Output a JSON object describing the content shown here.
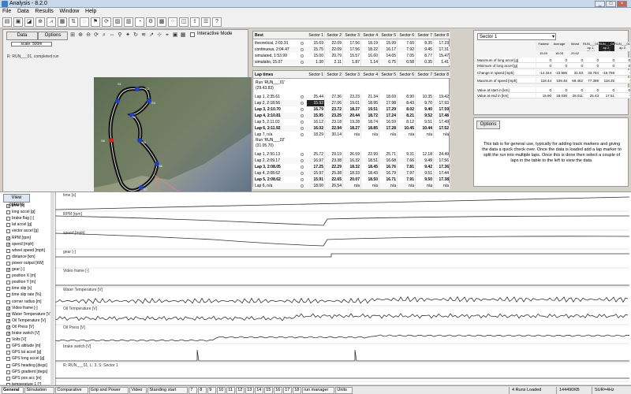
{
  "window": {
    "title": "Analysis - 8.2.0",
    "min": "_",
    "max": "□",
    "close": "×"
  },
  "menu": [
    "File",
    "Data",
    "Results",
    "Window",
    "Help"
  ],
  "map_panel": {
    "data_button": "Data",
    "options_button": "Options",
    "scale_label": "scale: 500m",
    "run_label": "R: RUN___01, completed run",
    "interactive_label": "Interactive Mode",
    "sector_labels": [
      "S1",
      "S2",
      "S3",
      "S4",
      "S5",
      "S6",
      "S7",
      "S8"
    ]
  },
  "best_table": {
    "header": [
      "Best",
      "Sector 1",
      "Sector 2",
      "Sector 3",
      "Sector 4",
      "Sector 5",
      "Sector 6",
      "Sector 7",
      "Sector 8"
    ],
    "rows": [
      {
        "label": "theoretical, 2:03.91",
        "cells": [
          "15.69",
          "22.09",
          "17.56",
          "18.19",
          "15.99",
          "7.60",
          "9.35",
          "17.23"
        ]
      },
      {
        "label": "continuous, 2:04.47",
        "cells": [
          "15.75",
          "22.09",
          "17.56",
          "18.22",
          "16.17",
          "7.92",
          "9.45",
          "17.31"
        ]
      },
      {
        "label": "simulated, 1:53.99",
        "cells": [
          "15.00",
          "20.79",
          "15.57",
          "16.60",
          "14.65",
          "7.05",
          "8.77",
          "15.47"
        ]
      },
      {
        "label": "simulatio, 15.07",
        "cells": [
          "1.30",
          "2.11",
          "1.87",
          "1.14",
          "0.75",
          "0.58",
          "0.35",
          "1.41"
        ]
      }
    ]
  },
  "laps_table": {
    "header": [
      "Lap times",
      "Sector 1",
      "Sector 2",
      "Sector 3",
      "Sector 4",
      "Sector 5",
      "Sector 6",
      "Sector 7",
      "Sector 8"
    ],
    "run1_label": "Run 'RUN___01'",
    "run1_sub": "(29.43.83)",
    "run2_label": "Run 'RUN___02'",
    "run2_sub": "(31.05.70)",
    "run1": [
      {
        "label": "Lap 1, 2:35.61",
        "cells": [
          "25.44",
          "27.36",
          "23.23",
          "21.34",
          "18.69",
          "8.90",
          "10.35",
          "19.42"
        ]
      },
      {
        "label": "Lap 2, 2:18.56",
        "cells": [
          "15.92",
          "27.06",
          "19.01",
          "18.95",
          "17.98",
          "8.43",
          "9.70",
          "17.93"
        ]
      },
      {
        "label": "Lap 3, 2:10.70",
        "cells": [
          "16.79",
          "23.72",
          "18.37",
          "19.51",
          "17.29",
          "8.02",
          "9.40",
          "17.59"
        ]
      },
      {
        "label": "Lap 4, 2:10.81",
        "cells": [
          "15.95",
          "23.25",
          "20.44",
          "18.72",
          "17.24",
          "8.21",
          "9.52",
          "17.48"
        ]
      },
      {
        "label": "Lap 5, 2:11.03",
        "cells": [
          "16.12",
          "23.18",
          "19.28",
          "18.74",
          "16.59",
          "8.12",
          "9.51",
          "17.49"
        ]
      },
      {
        "label": "Lap 6, 2:11.92",
        "cells": [
          "16.02",
          "22.94",
          "18.27",
          "18.85",
          "17.28",
          "10.45",
          "10.44",
          "17.52"
        ]
      },
      {
        "label": "Lap 7, n/a",
        "cells": [
          "18.29",
          "30.14",
          "n/a",
          "n/a",
          "n/a",
          "n/a",
          "n/a",
          "n/a"
        ]
      }
    ],
    "run2": [
      {
        "label": "Lap 1, 2:50.13",
        "cells": [
          "25.72",
          "29.19",
          "26.59",
          "22.99",
          "25.71",
          "9.31",
          "12.18",
          "24.49"
        ]
      },
      {
        "label": "Lap 2, 2:09.17",
        "cells": [
          "16.97",
          "23.38",
          "16.32",
          "18.51",
          "16.68",
          "7.66",
          "9.49",
          "17.56"
        ]
      },
      {
        "label": "Lap 3, 2:08.05",
        "cells": [
          "17.25",
          "22.29",
          "18.32",
          "18.45",
          "16.76",
          "7.81",
          "9.42",
          "17.36"
        ]
      },
      {
        "label": "Lap 4, 2:08.62",
        "cells": [
          "15.97",
          "25.38",
          "18.33",
          "18.43",
          "16.79",
          "7.97",
          "9.51",
          "17.44"
        ]
      },
      {
        "label": "Lap 5, 2:08.62",
        "cells": [
          "15.91",
          "22.65",
          "20.07",
          "18.50",
          "16.71",
          "7.91",
          "9.50",
          "17.38"
        ]
      },
      {
        "label": "Lap 6, n/a",
        "cells": [
          "18.00",
          "26.54",
          "n/a",
          "n/a",
          "n/a",
          "n/a",
          "n/a",
          "n/a"
        ]
      }
    ]
  },
  "sector_panel": {
    "dropdown": "Sector 1",
    "header": [
      "Fastest",
      "Average",
      "Worst",
      "RUN___01 ap 1, 23.44",
      "RUN___01 ap 2, 17.92",
      "RUN___01 ap 3"
    ],
    "header_sub": [
      "15.69",
      "18.05",
      "29.62",
      "",
      "",
      ""
    ],
    "rows": [
      {
        "label": "Maximum of long accel [g]",
        "cells": [
          "0",
          "0",
          "0",
          "0",
          "0",
          "0"
        ]
      },
      {
        "label": "Minimum of long accel [g]",
        "cells": [
          "0",
          "0",
          "0",
          "0",
          "0",
          "0"
        ]
      },
      {
        "label": "Change in speed [mph]",
        "cells": [
          "-14.344",
          "-10.586",
          "31.83",
          "33.784",
          "-16.758",
          "-"
        ]
      },
      {
        "label": "Maximum of speed [mph]",
        "cells": [
          "118.44",
          "109.46",
          "69.462",
          "77.389",
          "118.25",
          "-"
        ]
      },
      {
        "label": "Value at start in [km]",
        "cells": [
          "0",
          "0",
          "0",
          "0",
          "0",
          "0"
        ]
      },
      {
        "label": "Value at end in [km]",
        "cells": [
          "15.90",
          "18.036",
          "28.011",
          "25.43",
          "17.51",
          "-"
        ]
      }
    ]
  },
  "info_panel": {
    "options_button": "Options",
    "text": "This tab is for general use, typically for adding track markers and giving the data a quick check over. Once the data is loaded add a lap marker to split the run into multiple laps. Once this is done then select a couple of laps in the table to the left to view the data."
  },
  "channels": {
    "view_options": "View options",
    "items": [
      {
        "name": "time [s]",
        "checked": true
      },
      {
        "name": "long accel [g]",
        "checked": false
      },
      {
        "name": "brake flag [-]",
        "checked": false
      },
      {
        "name": "lat accel [g]",
        "checked": false
      },
      {
        "name": "vector accel [g]",
        "checked": false
      },
      {
        "name": "RPM [rpm]",
        "checked": true
      },
      {
        "name": "speed [mph]",
        "checked": true
      },
      {
        "name": "wheel speed [mph]",
        "checked": false
      },
      {
        "name": "distance [km]",
        "checked": false
      },
      {
        "name": "power output [kW]",
        "checked": false
      },
      {
        "name": "gear [-]",
        "checked": true
      },
      {
        "name": "position X [m]",
        "checked": false
      },
      {
        "name": "position Y [m]",
        "checked": false
      },
      {
        "name": "time slip [s]",
        "checked": false
      },
      {
        "name": "time slip rate [%]",
        "checked": false
      },
      {
        "name": "corner radius [m]",
        "checked": false
      },
      {
        "name": "Video frame [-]",
        "checked": true
      },
      {
        "name": "Water Temperature [V]",
        "checked": true
      },
      {
        "name": "Oil Temperature [V]",
        "checked": true
      },
      {
        "name": "Oil Press [V]",
        "checked": true
      },
      {
        "name": "brake switch [V]",
        "checked": true
      },
      {
        "name": "Volts [V]",
        "checked": false
      },
      {
        "name": "GPS altitude [m]",
        "checked": false
      },
      {
        "name": "GPS lat accel [g]",
        "checked": false
      },
      {
        "name": "GPS long accel [g]",
        "checked": false
      },
      {
        "name": "GPS heading [degs]",
        "checked": false
      },
      {
        "name": "GPS gradient [degs]",
        "checked": false
      },
      {
        "name": "GPS pos acc [m]",
        "checked": false
      },
      {
        "name": "temperature 1 [°]",
        "checked": false
      }
    ]
  },
  "traces": [
    {
      "label": "time [s]"
    },
    {
      "label": "RPM [rpm]"
    },
    {
      "label": "speed [mph]"
    },
    {
      "label": "gear [-]"
    },
    {
      "label": "Video frame [-]"
    },
    {
      "label": "Water Temperature [V]"
    },
    {
      "label": "Oil Temperature [V]"
    },
    {
      "label": "Oil Press [V]"
    },
    {
      "label": "brake switch [V]"
    },
    {
      "label": "R: RUN___01, L: 3, S: Sector 1"
    }
  ],
  "tabs": [
    "General",
    "Simulation",
    "Comparative",
    "Grip and Power",
    "Video",
    "Standing start",
    "7",
    "8",
    "9",
    "10",
    "11",
    "12",
    "13",
    "14",
    "15",
    "16",
    "17",
    "18",
    "run manager",
    "Units"
  ],
  "status": {
    "runs": "4 Runs Loaded",
    "memory": "144490KB",
    "info": "SUR=4Hz"
  }
}
